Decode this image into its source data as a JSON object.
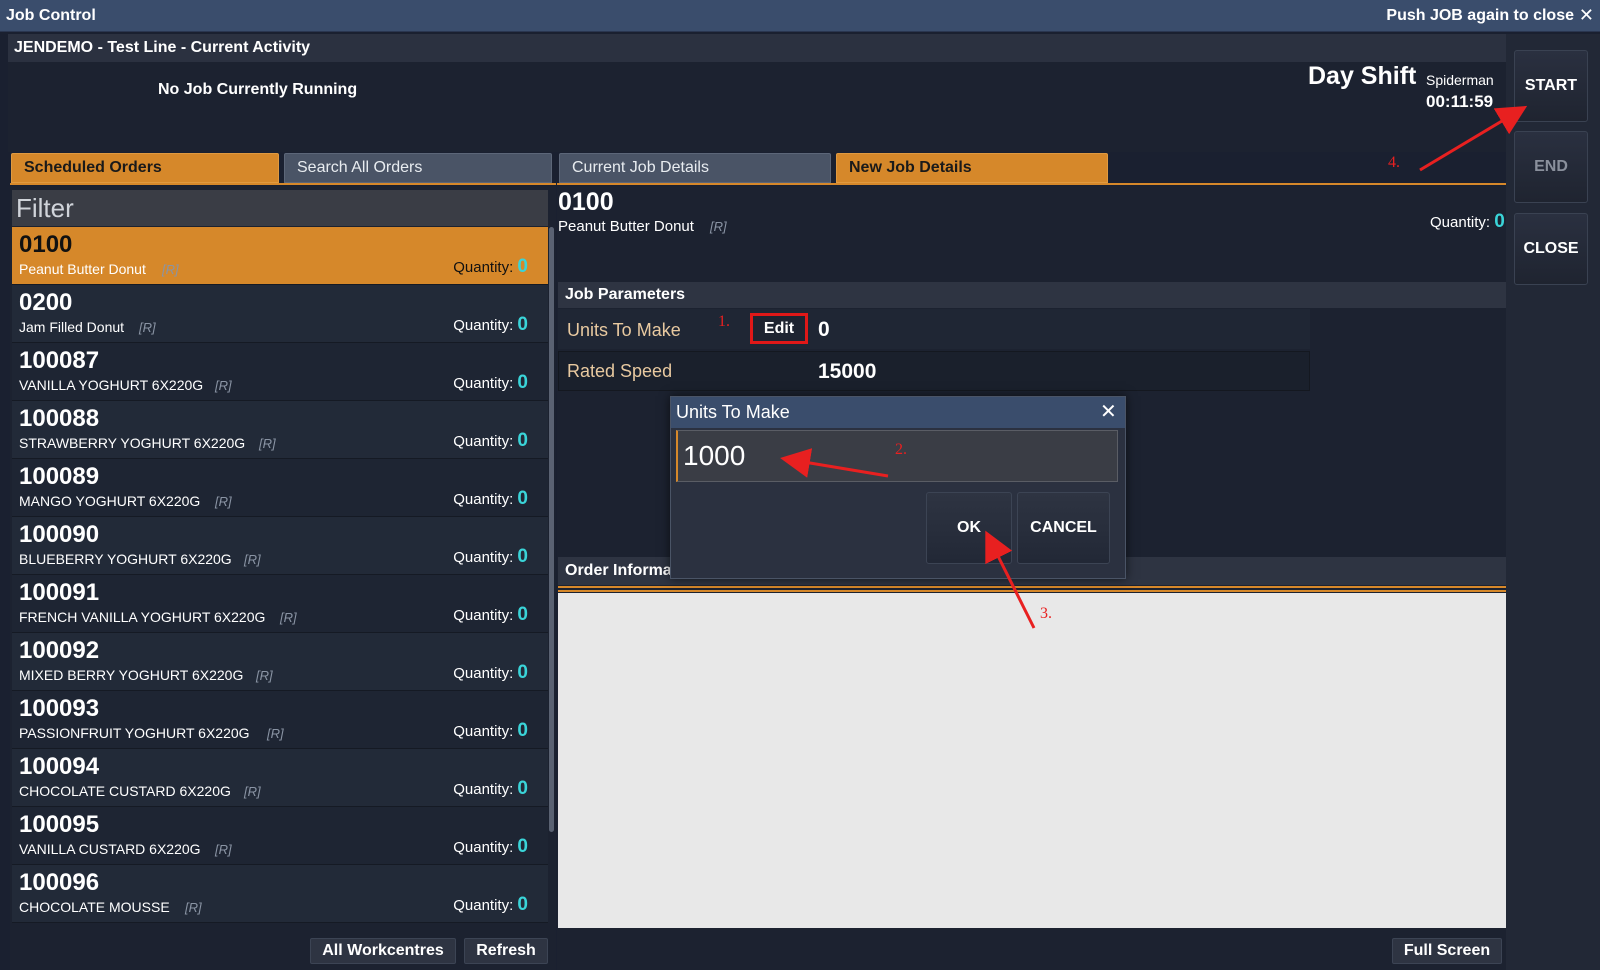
{
  "window": {
    "title": "Job Control",
    "close_hint": "Push JOB again to close",
    "close_glyph": "✕"
  },
  "header": {
    "line": "JENDEMO - Test Line - Current Activity",
    "job_status": "No Job Currently Running",
    "shift": "Day Shift",
    "user": "Spiderman",
    "clock": "00:11:59"
  },
  "side_buttons": {
    "start": "START",
    "end": "END",
    "close": "CLOSE"
  },
  "tabs": {
    "scheduled": "Scheduled Orders",
    "search": "Search All Orders",
    "current": "Current Job Details",
    "new": "New Job Details"
  },
  "filter": {
    "label": "Filter"
  },
  "orders": [
    {
      "code": "0100",
      "desc": "Peanut Butter Donut",
      "flag": "[R]",
      "qty_label": "Quantity:",
      "qty": "0"
    },
    {
      "code": "0200",
      "desc": "Jam Filled Donut",
      "flag": "[R]",
      "qty_label": "Quantity:",
      "qty": "0"
    },
    {
      "code": "100087",
      "desc": "VANILLA YOGHURT 6X220G",
      "flag": "[R]",
      "qty_label": "Quantity:",
      "qty": "0"
    },
    {
      "code": "100088",
      "desc": "STRAWBERRY YOGHURT 6X220G",
      "flag": "[R]",
      "qty_label": "Quantity:",
      "qty": "0"
    },
    {
      "code": "100089",
      "desc": "MANGO YOGHURT 6X220G",
      "flag": "[R]",
      "qty_label": "Quantity:",
      "qty": "0"
    },
    {
      "code": "100090",
      "desc": "BLUEBERRY YOGHURT 6X220G",
      "flag": "[R]",
      "qty_label": "Quantity:",
      "qty": "0"
    },
    {
      "code": "100091",
      "desc": "FRENCH VANILLA YOGHURT 6X220G",
      "flag": "[R]",
      "qty_label": "Quantity:",
      "qty": "0"
    },
    {
      "code": "100092",
      "desc": "MIXED BERRY YOGHURT 6X220G",
      "flag": "[R]",
      "qty_label": "Quantity:",
      "qty": "0"
    },
    {
      "code": "100093",
      "desc": "PASSIONFRUIT YOGHURT 6X220G",
      "flag": "[R]",
      "qty_label": "Quantity:",
      "qty": "0"
    },
    {
      "code": "100094",
      "desc": "CHOCOLATE CUSTARD 6X220G",
      "flag": "[R]",
      "qty_label": "Quantity:",
      "qty": "0"
    },
    {
      "code": "100095",
      "desc": "VANILLA CUSTARD 6X220G",
      "flag": "[R]",
      "qty_label": "Quantity:",
      "qty": "0"
    },
    {
      "code": "100096",
      "desc": "CHOCOLATE MOUSSE",
      "flag": "[R]",
      "qty_label": "Quantity:",
      "qty": "0"
    }
  ],
  "list_buttons": {
    "all_workcentres": "All Workcentres",
    "refresh": "Refresh"
  },
  "job_detail": {
    "code": "0100",
    "desc": "Peanut Butter Donut",
    "flag": "[R]",
    "qty_label": "Quantity:",
    "qty": "0"
  },
  "job_parameters": {
    "title": "Job Parameters",
    "units_label": "Units To Make",
    "edit_label": "Edit",
    "units_value": "0",
    "speed_label": "Rated Speed",
    "speed_value": "15000"
  },
  "order_info": {
    "title": "Order Informa"
  },
  "full_screen": "Full Screen",
  "modal": {
    "title": "Units To Make",
    "close_glyph": "✕",
    "input_value": "1000",
    "ok": "OK",
    "cancel": "CANCEL"
  },
  "annotations": {
    "a1": "1.",
    "a2": "2.",
    "a3": "3.",
    "a4": "4.",
    "color": "#e82020"
  },
  "colors": {
    "accent": "#d6882a",
    "quantity": "#3ad4d8",
    "titlebar": "#3a4d6c"
  }
}
